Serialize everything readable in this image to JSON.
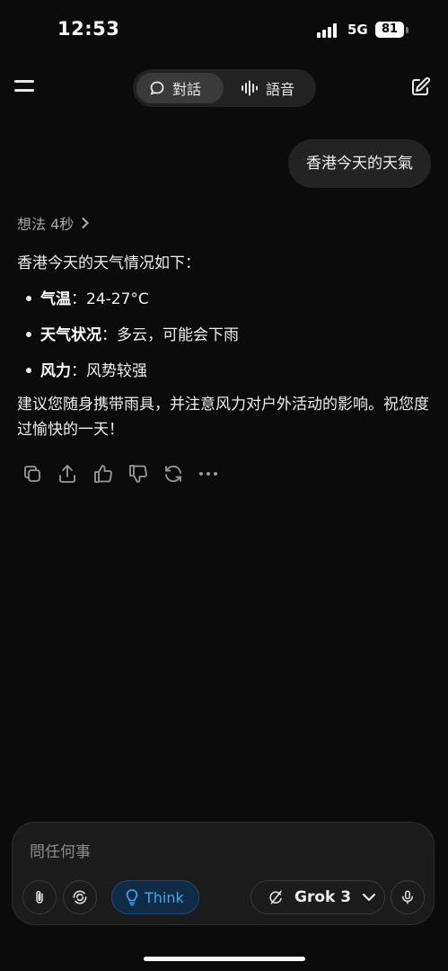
{
  "status_bar": {
    "time": "12:53",
    "network": "5G",
    "battery": "81"
  },
  "nav": {
    "tabs": [
      {
        "label": "對話",
        "icon": "chat-bubble-icon",
        "active": true
      },
      {
        "label": "語音",
        "icon": "voice-wave-icon",
        "active": false
      }
    ]
  },
  "conversation": {
    "user_message": "香港今天的天氣",
    "thought_label": "想法 4秒",
    "intro": "香港今天的天气情况如下：",
    "bullets": [
      {
        "term": "气温",
        "value": "：24-27°C"
      },
      {
        "term": "天气状况",
        "value": "：多云，可能会下雨"
      },
      {
        "term": "风力",
        "value": "：风势较强"
      }
    ],
    "advice": "建议您随身携带雨具，并注意风力对户外活动的影响。祝您度过愉快的一天！",
    "actions": [
      "copy-icon",
      "share-icon",
      "thumbs-up-icon",
      "thumbs-down-icon",
      "regenerate-icon",
      "more-icon"
    ]
  },
  "composer": {
    "placeholder": "問任何事",
    "think_label": "Think",
    "model_label": "Grok 3"
  },
  "colors": {
    "background": "#0b0b0b",
    "think_accent": "#3ea6f5"
  }
}
